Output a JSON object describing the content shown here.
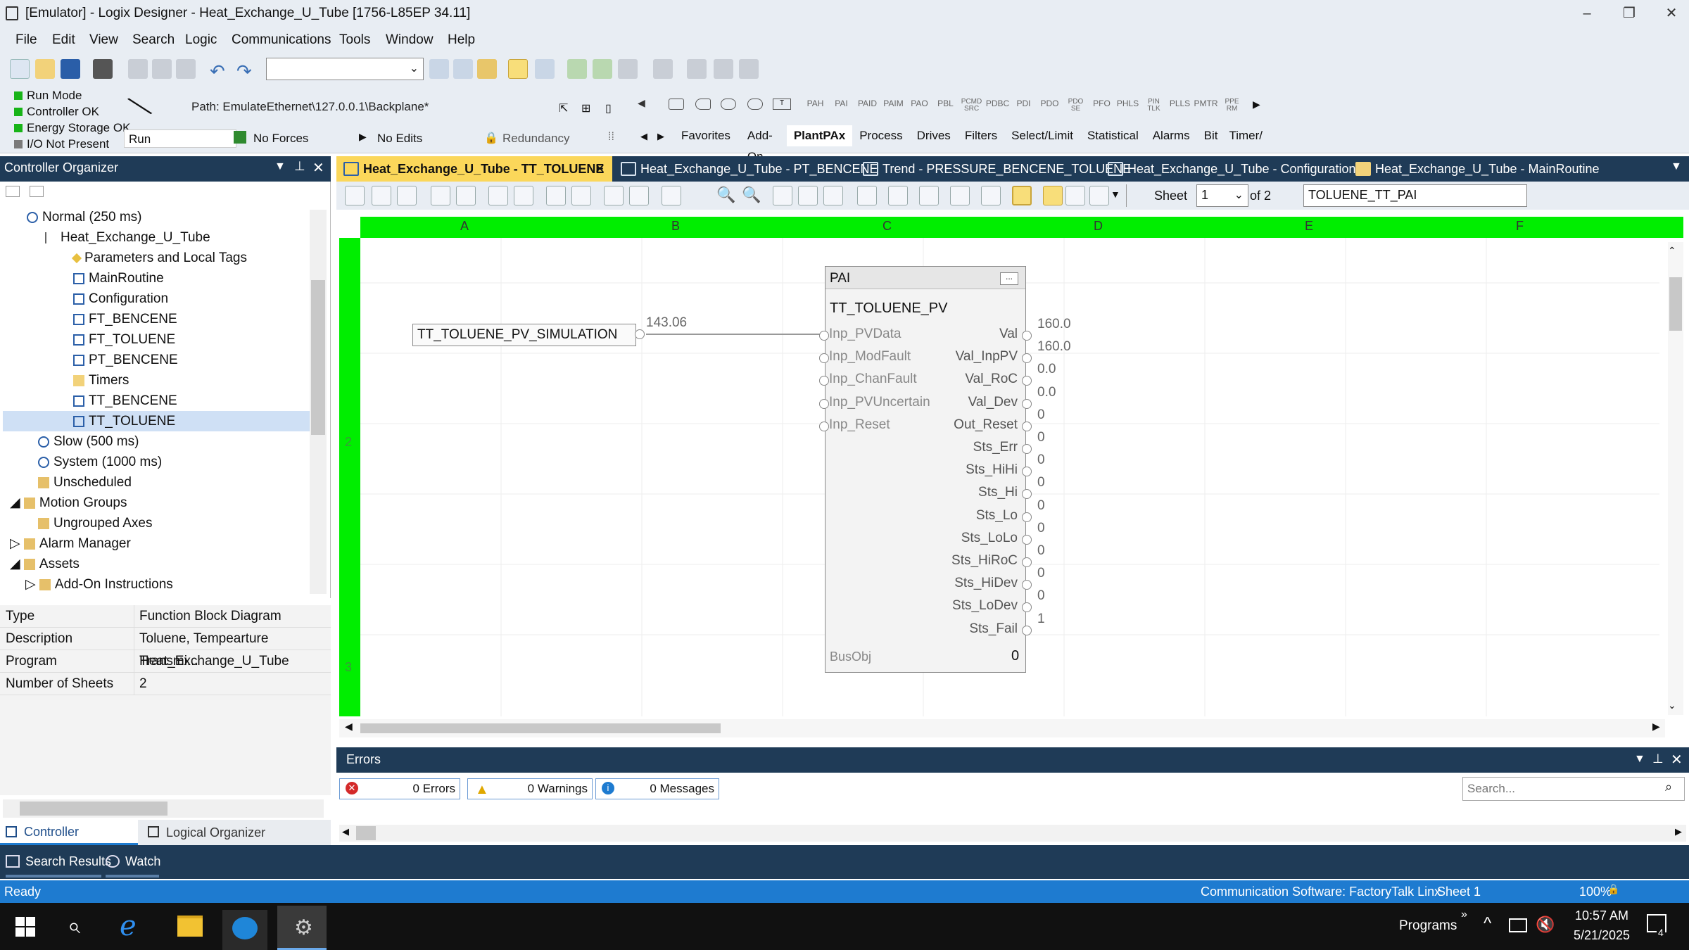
{
  "window": {
    "title": "[Emulator] - Logix Designer - Heat_Exchange_U_Tube [1756-L85EP 34.11]"
  },
  "menu": [
    "File",
    "Edit",
    "View",
    "Search",
    "Logic",
    "Communications",
    "Tools",
    "Window",
    "Help"
  ],
  "status_panel": {
    "run_mode": "Run Mode",
    "controller_ok": "Controller OK",
    "energy_storage": "Energy Storage OK",
    "io": "I/O Not Present",
    "mode": "Run",
    "forces": "No Forces",
    "edits": "No Edits",
    "redundancy": "Redundancy",
    "path": "Path: EmulateEthernet\\127.0.0.1\\Backplane*"
  },
  "instr_buttons": [
    "PAH",
    "PAI",
    "PAID",
    "PAIM",
    "PAO",
    "PBL",
    "PCMD SRC",
    "PDBC",
    "PDI",
    "PDO",
    "PDO SE",
    "PFO",
    "PHLS",
    "PIN TLK",
    "PLLS",
    "PMTR",
    "PPE RM"
  ],
  "instr_tabs": [
    "Favorites",
    "Add-On",
    "PlantPAx",
    "Process",
    "Drives",
    "Filters",
    "Select/Limit",
    "Statistical",
    "Alarms",
    "Bit",
    "Timer/"
  ],
  "doc_tabs": [
    "Heat_Exchange_U_Tube - TT_TOLUENE",
    "Heat_Exchange_U_Tube - PT_BENCENE",
    "Trend - PRESSURE_BENCENE_TOLUENE",
    "Heat_Exchange_U_Tube - Configuration",
    "Heat_Exchange_U_Tube - MainRoutine"
  ],
  "organizer": {
    "title": "Controller Organizer",
    "items": [
      "Normal (250 ms)",
      "Heat_Exchange_U_Tube",
      "Parameters and Local Tags",
      "MainRoutine",
      "Configuration",
      "FT_BENCENE",
      "FT_TOLUENE",
      "PT_BENCENE",
      "Timers",
      "TT_BENCENE",
      "TT_TOLUENE",
      "Slow (500 ms)",
      "System (1000 ms)",
      "Unscheduled",
      "Motion Groups",
      "Ungrouped Axes",
      "Alarm Manager",
      "Assets",
      "Add-On Instructions"
    ]
  },
  "properties": [
    [
      "Type",
      "Function Block Diagram"
    ],
    [
      "Description",
      "Toluene, Tempearture Transmi..."
    ],
    [
      "Program",
      "Heat_Exchange_U_Tube"
    ],
    [
      "Number of Sheets",
      "2"
    ]
  ],
  "org_tabs": [
    "Controller Organizer",
    "Logical Organizer"
  ],
  "fbd_toolbar": {
    "sheet_label": "Sheet",
    "sheet_value": "1",
    "of_label": "of 2",
    "tag_name": "TOLUENE_TT_PAI"
  },
  "columns": [
    "A",
    "B",
    "C",
    "D",
    "E",
    "F"
  ],
  "rows": [
    "2",
    "3"
  ],
  "block": {
    "type": "PAI",
    "tag": "TT_TOLUENE_PV",
    "input_ref": "TT_TOLUENE_PV_SIMULATION",
    "input_value": "143.06",
    "busobj": "BusObj",
    "busobj_value": "0",
    "inputs": [
      "Inp_PVData",
      "Inp_ModFault",
      "Inp_ChanFault",
      "Inp_PVUncertain",
      "Inp_Reset"
    ],
    "outputs": [
      "Val",
      "Val_InpPV",
      "Val_RoC",
      "Val_Dev",
      "Out_Reset",
      "Sts_Err",
      "Sts_HiHi",
      "Sts_Hi",
      "Sts_Lo",
      "Sts_LoLo",
      "Sts_HiRoC",
      "Sts_HiDev",
      "Sts_LoDev",
      "Sts_Fail"
    ],
    "output_values": [
      "160.0",
      "160.0",
      "0.0",
      "0.0",
      "0",
      "0",
      "0",
      "0",
      "0",
      "0",
      "0",
      "0",
      "0",
      "1"
    ]
  },
  "errors": {
    "title": "Errors",
    "errors": "0 Errors",
    "warnings": "0 Warnings",
    "messages": "0 Messages",
    "search_placeholder": "Search..."
  },
  "bottom_tabs": [
    "Search Results",
    "Watch"
  ],
  "statusbar": {
    "ready": "Ready",
    "comm": "Communication Software: FactoryTalk Linx",
    "sheet": "Sheet 1",
    "zoom": "100%"
  },
  "taskbar": {
    "programs": "Programs",
    "time": "10:57 AM",
    "date": "5/21/2025",
    "notif": "4"
  }
}
